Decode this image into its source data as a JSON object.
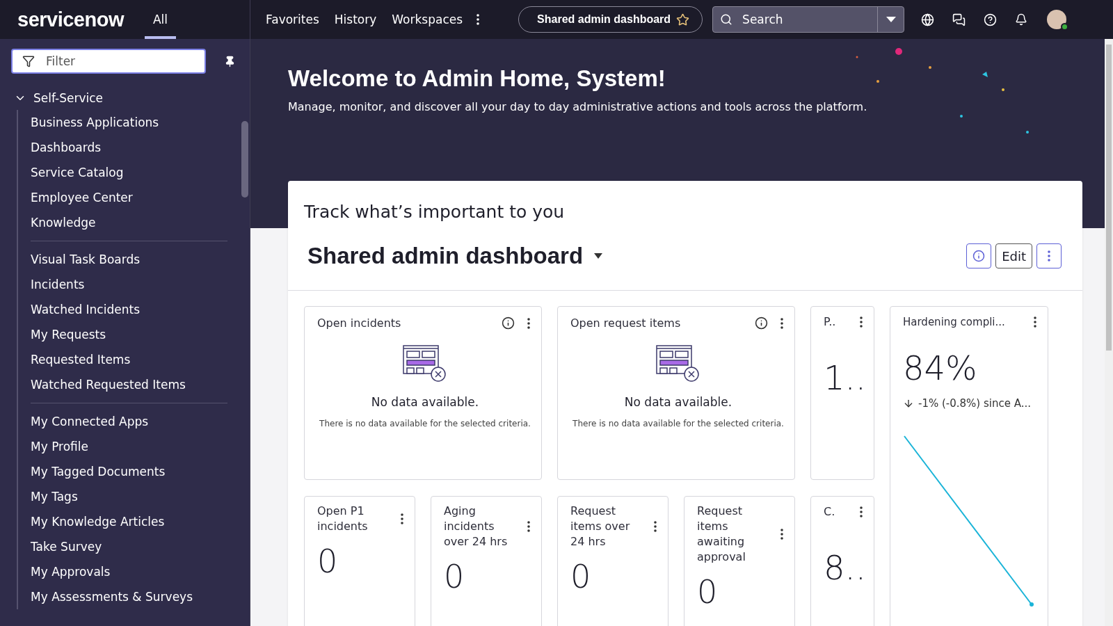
{
  "top_bar": {
    "logo": "servicenow",
    "tabs": [
      {
        "label": "All",
        "selected": true
      }
    ],
    "links": [
      "Favorites",
      "History",
      "Workspaces"
    ],
    "context_pill": {
      "label": "Shared admin dashboard",
      "favorite": false
    },
    "search": {
      "placeholder": "Search"
    },
    "avatar": {
      "online": true
    }
  },
  "sidebar": {
    "filter": {
      "placeholder": "Filter"
    },
    "tree": [
      {
        "label": "Self-Service",
        "expanded": true,
        "groups": [
          [
            "Business Applications",
            "Dashboards",
            "Service Catalog",
            "Employee Center",
            "Knowledge"
          ],
          [
            "Visual Task Boards",
            "Incidents",
            "Watched Incidents",
            "My Requests",
            "Requested Items",
            "Watched Requested Items"
          ],
          [
            "My Connected Apps",
            "My Profile",
            "My Tagged Documents",
            "My Tags",
            "My Knowledge Articles",
            "Take Survey",
            "My Approvals",
            "My Assessments & Surveys"
          ]
        ]
      }
    ]
  },
  "hero": {
    "title": "Welcome to Admin Home, System!",
    "subtitle": "Manage, monitor, and discover all your day to day administrative actions and tools across the platform."
  },
  "dashboard": {
    "heading": "Track what’s important to you",
    "title": "Shared admin dashboard",
    "edit_label": "Edit",
    "tiles": [
      {
        "kind": "empty",
        "title": "Open incidents",
        "message": "No data available.",
        "detail": "There is no data available for the selected criteria."
      },
      {
        "kind": "empty",
        "title": "Open request items",
        "message": "No data available.",
        "detail": "There is no data available for the selected criteria."
      },
      {
        "kind": "narrow",
        "title": "P..",
        "value": "1.."
      },
      {
        "kind": "trend",
        "title": "Hardening compli...",
        "value": "84%",
        "change": "-1% (-0.8%) since A..."
      },
      {
        "kind": "score",
        "title": "Open P1 incidents",
        "value": "0"
      },
      {
        "kind": "score",
        "title": "Aging incidents over 24 hrs",
        "value": "0"
      },
      {
        "kind": "score",
        "title": "Request items over 24 hrs",
        "value": "0"
      },
      {
        "kind": "score",
        "title": "Request items awaiting approval",
        "value": "0"
      },
      {
        "kind": "narrow",
        "title": "C.",
        "value": "8.."
      }
    ]
  }
}
